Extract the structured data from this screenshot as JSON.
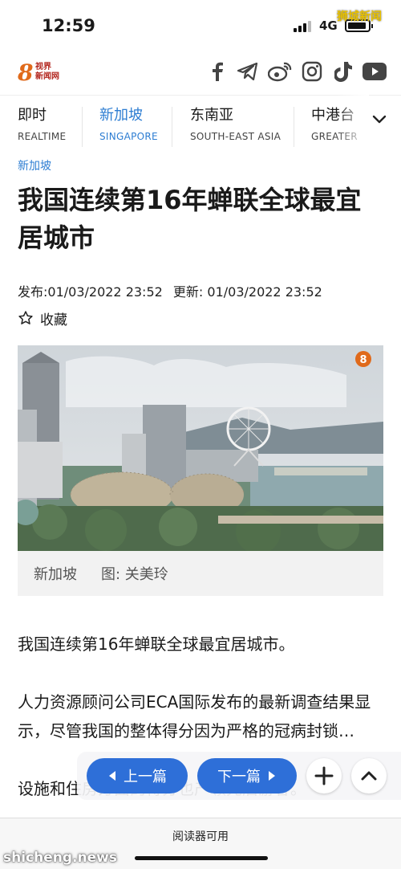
{
  "status_bar": {
    "time": "12:59",
    "network": "4G"
  },
  "watermarks": {
    "top": "狮城新闻",
    "bottom": "shicheng.news"
  },
  "header": {
    "logo_eight": "8",
    "logo_line1": "视界",
    "logo_line2": "新闻网",
    "social_icons": [
      "facebook-icon",
      "telegram-icon",
      "weibo-icon",
      "instagram-icon",
      "tiktok-icon",
      "youtube-icon"
    ]
  },
  "nav": {
    "tabs": [
      {
        "cn": "即时",
        "en": "REALTIME"
      },
      {
        "cn": "新加坡",
        "en": "SINGAPORE"
      },
      {
        "cn": "东南亚",
        "en": "SOUTH-EAST ASIA"
      },
      {
        "cn": "中港台",
        "en": "GREATER C"
      }
    ],
    "active_index": 1
  },
  "article": {
    "category": "新加坡",
    "headline": "我国连续第16年蝉联全球最宜居城市",
    "published": "发布:01/03/2022 23:52",
    "updated": "更新: 01/03/2022 23:52",
    "bookmark_label": "收藏",
    "photo_badge": "8",
    "caption_location": "新加坡",
    "caption_credit": "图: 关美玲",
    "paragraph1": "我国连续第16年蝉联全球最宜居城市。",
    "paragraph2": "人力资源顾问公司ECA国际发布的最新调查结果显示，尽管我国的整体得分因为严格的冠病封锁…",
    "paragraph2_line4": "设施和住房方面的得分也产领先后游客。"
  },
  "floating_nav": {
    "prev_label": "上一篇",
    "next_label": "下一篇"
  },
  "reader": {
    "label": "阅读器可用"
  },
  "colors": {
    "accent": "#2d7dd2",
    "button": "#2e6fd8",
    "logo_orange": "#e06a1b"
  }
}
